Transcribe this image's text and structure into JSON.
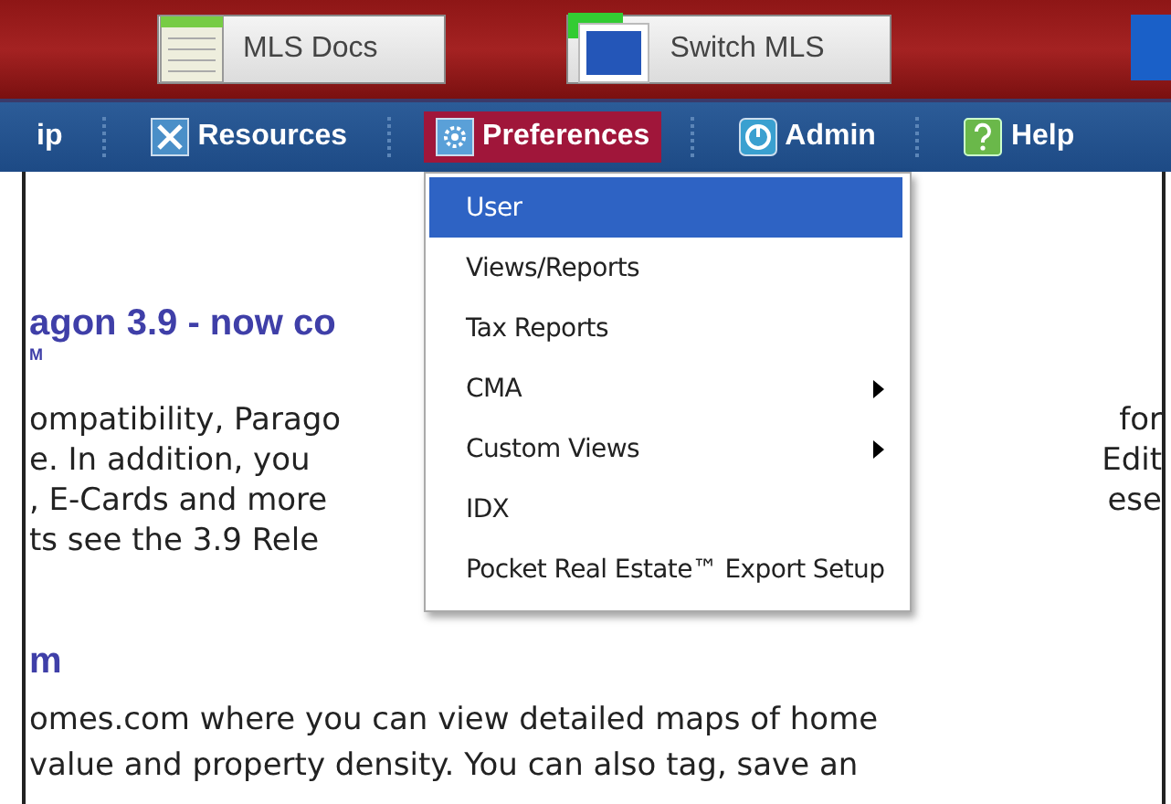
{
  "toolbar": {
    "buttons": [
      {
        "label": "MLS Docs"
      },
      {
        "label": "Switch MLS"
      }
    ]
  },
  "nav": {
    "items": [
      {
        "label": "ip",
        "selected": false
      },
      {
        "label": "Resources",
        "selected": false
      },
      {
        "label": "Preferences",
        "selected": true
      },
      {
        "label": "Admin",
        "selected": false
      },
      {
        "label": "Help",
        "selected": false
      }
    ]
  },
  "menu": {
    "items": [
      {
        "label": "User",
        "selected": true,
        "submenu": false
      },
      {
        "label": "Views/Reports",
        "selected": false,
        "submenu": false
      },
      {
        "label": "Tax Reports",
        "selected": false,
        "submenu": false
      },
      {
        "label": "CMA",
        "selected": false,
        "submenu": true
      },
      {
        "label": "Custom Views",
        "selected": false,
        "submenu": true
      },
      {
        "label": "IDX",
        "selected": false,
        "submenu": false
      },
      {
        "label": "Pocket Real Estate™ Export Setup",
        "selected": false,
        "submenu": false
      }
    ]
  },
  "content": {
    "title": "agon 3.9 - now co",
    "subtitle": "M",
    "lines": [
      {
        "left": "ompatibility, Parago",
        "right": "for"
      },
      {
        "left": "e. In addition, you",
        "right": "Edit"
      },
      {
        "left": ", E-Cards and more",
        "right": "ese"
      },
      {
        "left": "ts see the 3.9 Rele"
      }
    ],
    "heading_2": "m",
    "lines_2": [
      "omes.com where you can view detailed maps of home",
      "value and property density. You can also tag, save an"
    ]
  }
}
